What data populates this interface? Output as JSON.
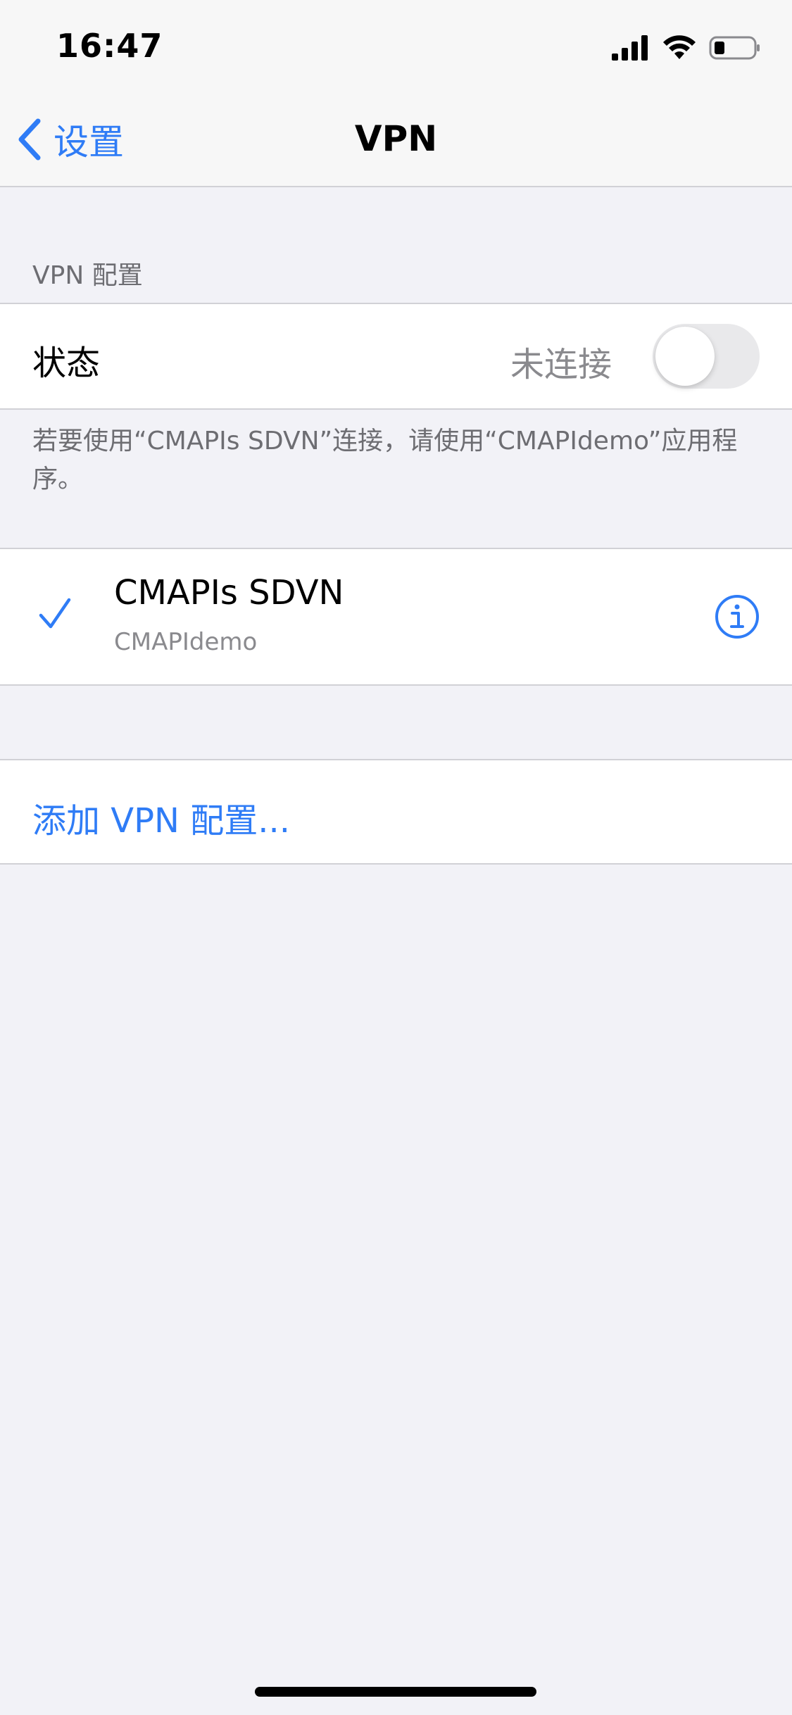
{
  "status_bar": {
    "time": "16:47",
    "icons": [
      "cellular-signal-icon",
      "wifi-icon",
      "battery-icon"
    ]
  },
  "nav": {
    "back_label": "设置",
    "title": "VPN"
  },
  "section": {
    "header": "VPN 配置",
    "status_label": "状态",
    "status_value": "未连接",
    "toggle_on": false,
    "footer_note": "若要使用“CMAPIs SDVN”连接，请使用“CMAPIdemo”应用程序。"
  },
  "vpn_configs": [
    {
      "name": "CMAPIs SDVN",
      "app": "CMAPIdemo",
      "selected": true
    }
  ],
  "add_vpn_label": "添加 VPN 配置...",
  "colors": {
    "accent": "#2f7cf6",
    "background": "#f2f2f7",
    "secondary_text": "#8a8a8e"
  }
}
